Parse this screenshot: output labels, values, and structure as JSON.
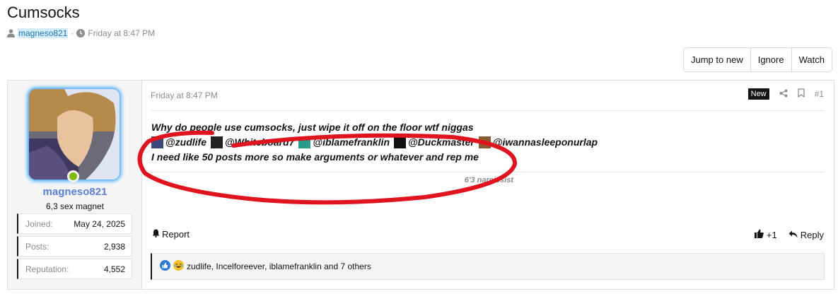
{
  "thread": {
    "title": "Cumsocks",
    "author": "magneso821",
    "separator": "·",
    "date": "Friday at 8:47 PM"
  },
  "thread_buttons": [
    "Jump to new",
    "Ignore",
    "Watch"
  ],
  "user": {
    "name": "magneso821",
    "title": "6,3 sex magnet",
    "stats": [
      {
        "label": "Joined:",
        "value": "May 24, 2025"
      },
      {
        "label": "Posts:",
        "value": "2,938"
      },
      {
        "label": "Reputation:",
        "value": "4,552"
      }
    ],
    "online_color": "#7fb900"
  },
  "post": {
    "date": "Friday at 8:47 PM",
    "new_label": "New",
    "number": "#1",
    "line1": "Why do people use cumsocks, just wipe it off on the floor wtf niggas",
    "mentions": [
      "@zudlife",
      "@Whiteboard7",
      "@iblamefranklin",
      "@Duckmaster",
      "@iwannasleeponurlap"
    ],
    "line3": "I need like 50 posts more so make arguments or whatever and rep me",
    "signature": "6'3 narcissist"
  },
  "actions": {
    "report": "Report",
    "like_count": "+1",
    "reply": "Reply"
  },
  "reactions_text": "zudlife, Incelforeever, iblamefranklin and 7 others",
  "colors": {
    "accent": "#2577b1",
    "username": "#5d7fd8",
    "scribble": "#e0141e"
  }
}
